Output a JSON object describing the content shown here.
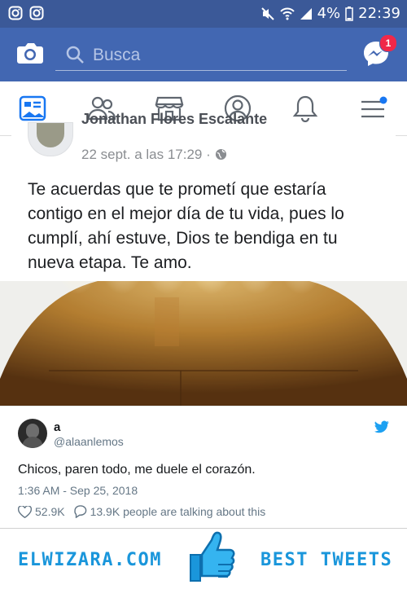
{
  "status_bar": {
    "battery": "4%",
    "time": "22:39"
  },
  "fb_header": {
    "search_placeholder": "Busca",
    "messenger_badge": "1"
  },
  "fb_tabs": [
    "news-feed",
    "friends",
    "marketplace",
    "profile",
    "notifications",
    "menu"
  ],
  "post": {
    "author": "Jonathan Flores Escalante",
    "time": "22 sept. a las 17:29 ·",
    "text": "Te acuerdas que te prometí que estaría contigo en el mejor día de tu vida, pues lo cumplí, ahí estuve, Dios te bendiga en tu nueva etapa. Te amo."
  },
  "tweet": {
    "name": "a",
    "handle": "@alaanlemos",
    "text": "Chicos, paren todo, me duele el corazón.",
    "datetime": "1:36 AM - Sep 25, 2018",
    "likes": "52.9K",
    "replies": "13.9K people are talking about this"
  },
  "footer": {
    "left": "ELWIZARA.COM",
    "right": "BEST TWEETS"
  },
  "colors": {
    "facebook_blue": "#4267b2",
    "twitter_blue": "#1da1f2",
    "brand_blue": "#1a96db"
  }
}
